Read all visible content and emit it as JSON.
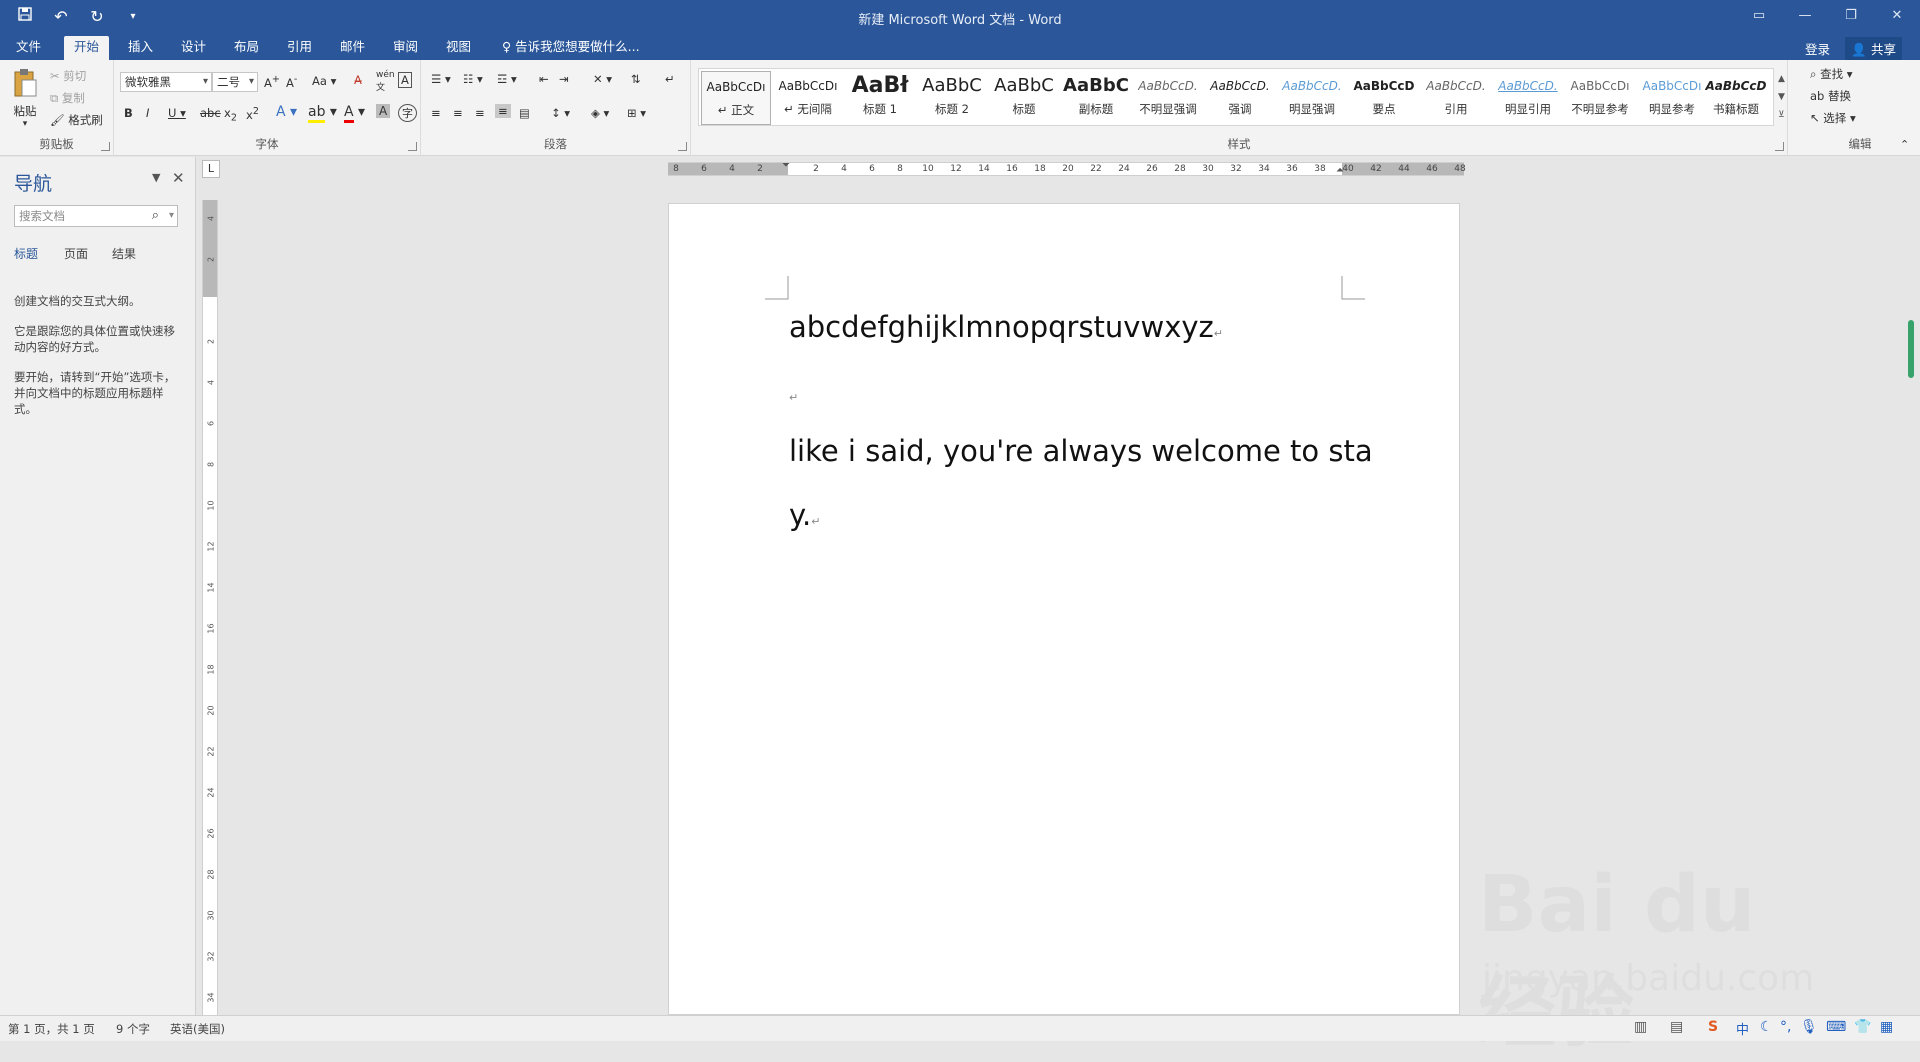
{
  "window": {
    "title": "新建 Microsoft Word 文档 - Word",
    "qat": {
      "save_icon": "save-icon",
      "undo_icon": "undo-icon",
      "redo_icon": "redo-icon",
      "customize_icon": "chevron-down-icon"
    }
  },
  "tabs": {
    "items": [
      "文件",
      "开始",
      "插入",
      "设计",
      "布局",
      "引用",
      "邮件",
      "审阅",
      "视图"
    ],
    "active": "开始",
    "tell_me": "告诉我您想要做什么...",
    "login": "登录",
    "share": "共享"
  },
  "ribbon": {
    "clipboard": {
      "label": "剪贴板",
      "paste": "粘贴",
      "cut": "剪切",
      "copy": "复制",
      "format_painter": "格式刷"
    },
    "font": {
      "label": "字体",
      "font_name": "微软雅黑",
      "font_size": "二号",
      "change_case": "Aa"
    },
    "paragraph": {
      "label": "段落"
    },
    "styles": {
      "label": "样式",
      "items": [
        {
          "preview": "AaBbCcDı",
          "name": "↵ 正文"
        },
        {
          "preview": "AaBbCcDı",
          "name": "↵ 无间隔"
        },
        {
          "preview": "AaBł",
          "name": "标题 1"
        },
        {
          "preview": "AaBbC",
          "name": "标题 2"
        },
        {
          "preview": "AaBbC",
          "name": "标题"
        },
        {
          "preview": "AaBbC",
          "name": "副标题"
        },
        {
          "preview": "AaBbCcD.",
          "name": "不明显强调"
        },
        {
          "preview": "AaBbCcD.",
          "name": "强调"
        },
        {
          "preview": "AaBbCcD.",
          "name": "明显强调"
        },
        {
          "preview": "AaBbCcD",
          "name": "要点"
        },
        {
          "preview": "AaBbCcD.",
          "name": "引用"
        },
        {
          "preview": "AaBbCcD.",
          "name": "明显引用"
        },
        {
          "preview": "AaBbCcDı",
          "name": "不明显参考"
        },
        {
          "preview": "AaBbCcDı",
          "name": "明显参考"
        },
        {
          "preview": "AaBbCcD",
          "name": "书籍标题"
        }
      ]
    },
    "editing": {
      "label": "编辑",
      "find": "查找",
      "replace": "替换",
      "select": "选择"
    }
  },
  "nav": {
    "title": "导航",
    "search_placeholder": "搜索文档",
    "tabs": [
      "标题",
      "页面",
      "结果"
    ],
    "text1": "创建文档的交互式大纲。",
    "text2": "它是跟踪您的具体位置或快速移动内容的好方式。",
    "text3": "要开始，请转到“开始”选项卡，并向文档中的标题应用标题样式。"
  },
  "ruler": {
    "h_ticks": [
      "8",
      "6",
      "4",
      "2",
      "",
      "2",
      "4",
      "6",
      "8",
      "10",
      "12",
      "14",
      "16",
      "18",
      "20",
      "22",
      "24",
      "26",
      "28",
      "30",
      "32",
      "34",
      "36",
      "38",
      "40",
      "42",
      "44",
      "46",
      "48"
    ],
    "v_ticks": [
      "4",
      "2",
      "",
      "2",
      "4",
      "6",
      "8",
      "10",
      "12",
      "14",
      "16",
      "18",
      "20",
      "22",
      "24",
      "26",
      "28",
      "30",
      "32",
      "34"
    ],
    "corner": "L"
  },
  "document": {
    "line1": "abcdefghijklmnopqrstuvwxyz",
    "line2": "",
    "line3": "like i said, you're always welcome to sta",
    "line4": "y.",
    "para_mark": "↵"
  },
  "status": {
    "page": "第 1 页，共 1 页",
    "words": "9 个字",
    "lang": "英语(美国)"
  },
  "watermark": {
    "brand": "Bai du 经验",
    "url": "jingyan.baidu.com"
  },
  "colors": {
    "accent": "#2b579a",
    "scroll_thumb": "#37a36b"
  }
}
